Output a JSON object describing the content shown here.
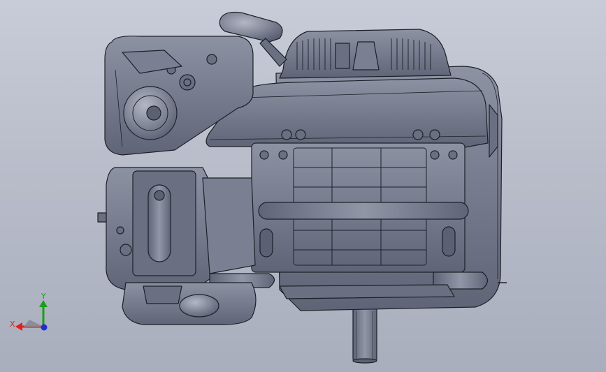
{
  "viewport": {
    "background_top": "#c8ccd8",
    "background_bottom": "#a9aebd"
  },
  "model": {
    "body_color": "#72778a",
    "shade_color": "#5b6073",
    "highlight_color": "#a0a5b5",
    "edge_color": "#1e2028"
  },
  "triad": {
    "x_label": "X",
    "y_label": "Y",
    "x_color": "#e02020",
    "y_color": "#18a018",
    "z_color": "#2030d0"
  }
}
